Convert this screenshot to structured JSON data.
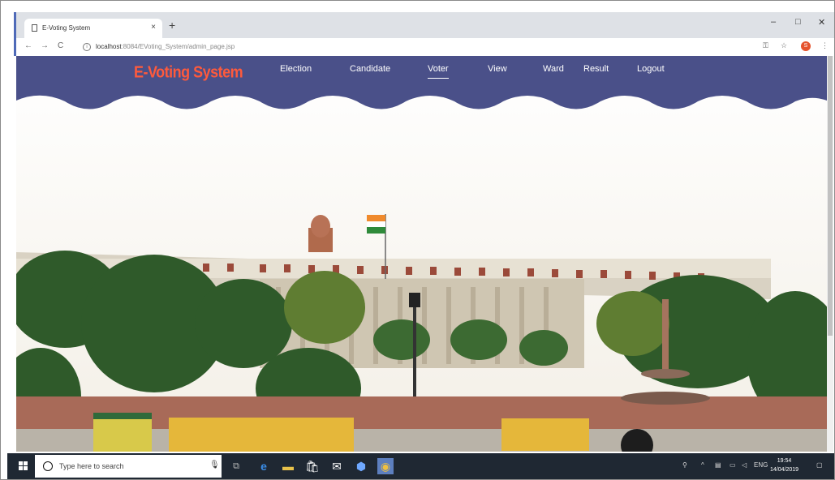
{
  "browser": {
    "tab_title": "E-Voting System",
    "tab_close": "×",
    "new_tab": "+",
    "url_host": "localhost",
    "url_path": ":8084/EVoting_System/admin_page.jsp",
    "window_controls": [
      "–",
      "□",
      "✕"
    ],
    "profile_initial": "S"
  },
  "site": {
    "brand": "E-Voting System",
    "nav": [
      "Election",
      "Candidate",
      "Voter",
      "View",
      "Ward",
      "Result",
      "Logout"
    ],
    "active_nav": "Voter",
    "colors": {
      "navbar": "#4a5089",
      "brand": "#ff5a3c",
      "sky": "#f7f6f2"
    }
  },
  "taskbar": {
    "search_placeholder": "Type here to search",
    "lang": "ENG",
    "time": "19:54",
    "date": "14/04/2019"
  },
  "icons": [
    "windows-start-icon",
    "search-icon",
    "mic-icon",
    "task-view-icon",
    "edge-icon",
    "file-explorer-icon",
    "store-icon",
    "mail-icon",
    "shield-icon",
    "chrome-icon"
  ]
}
